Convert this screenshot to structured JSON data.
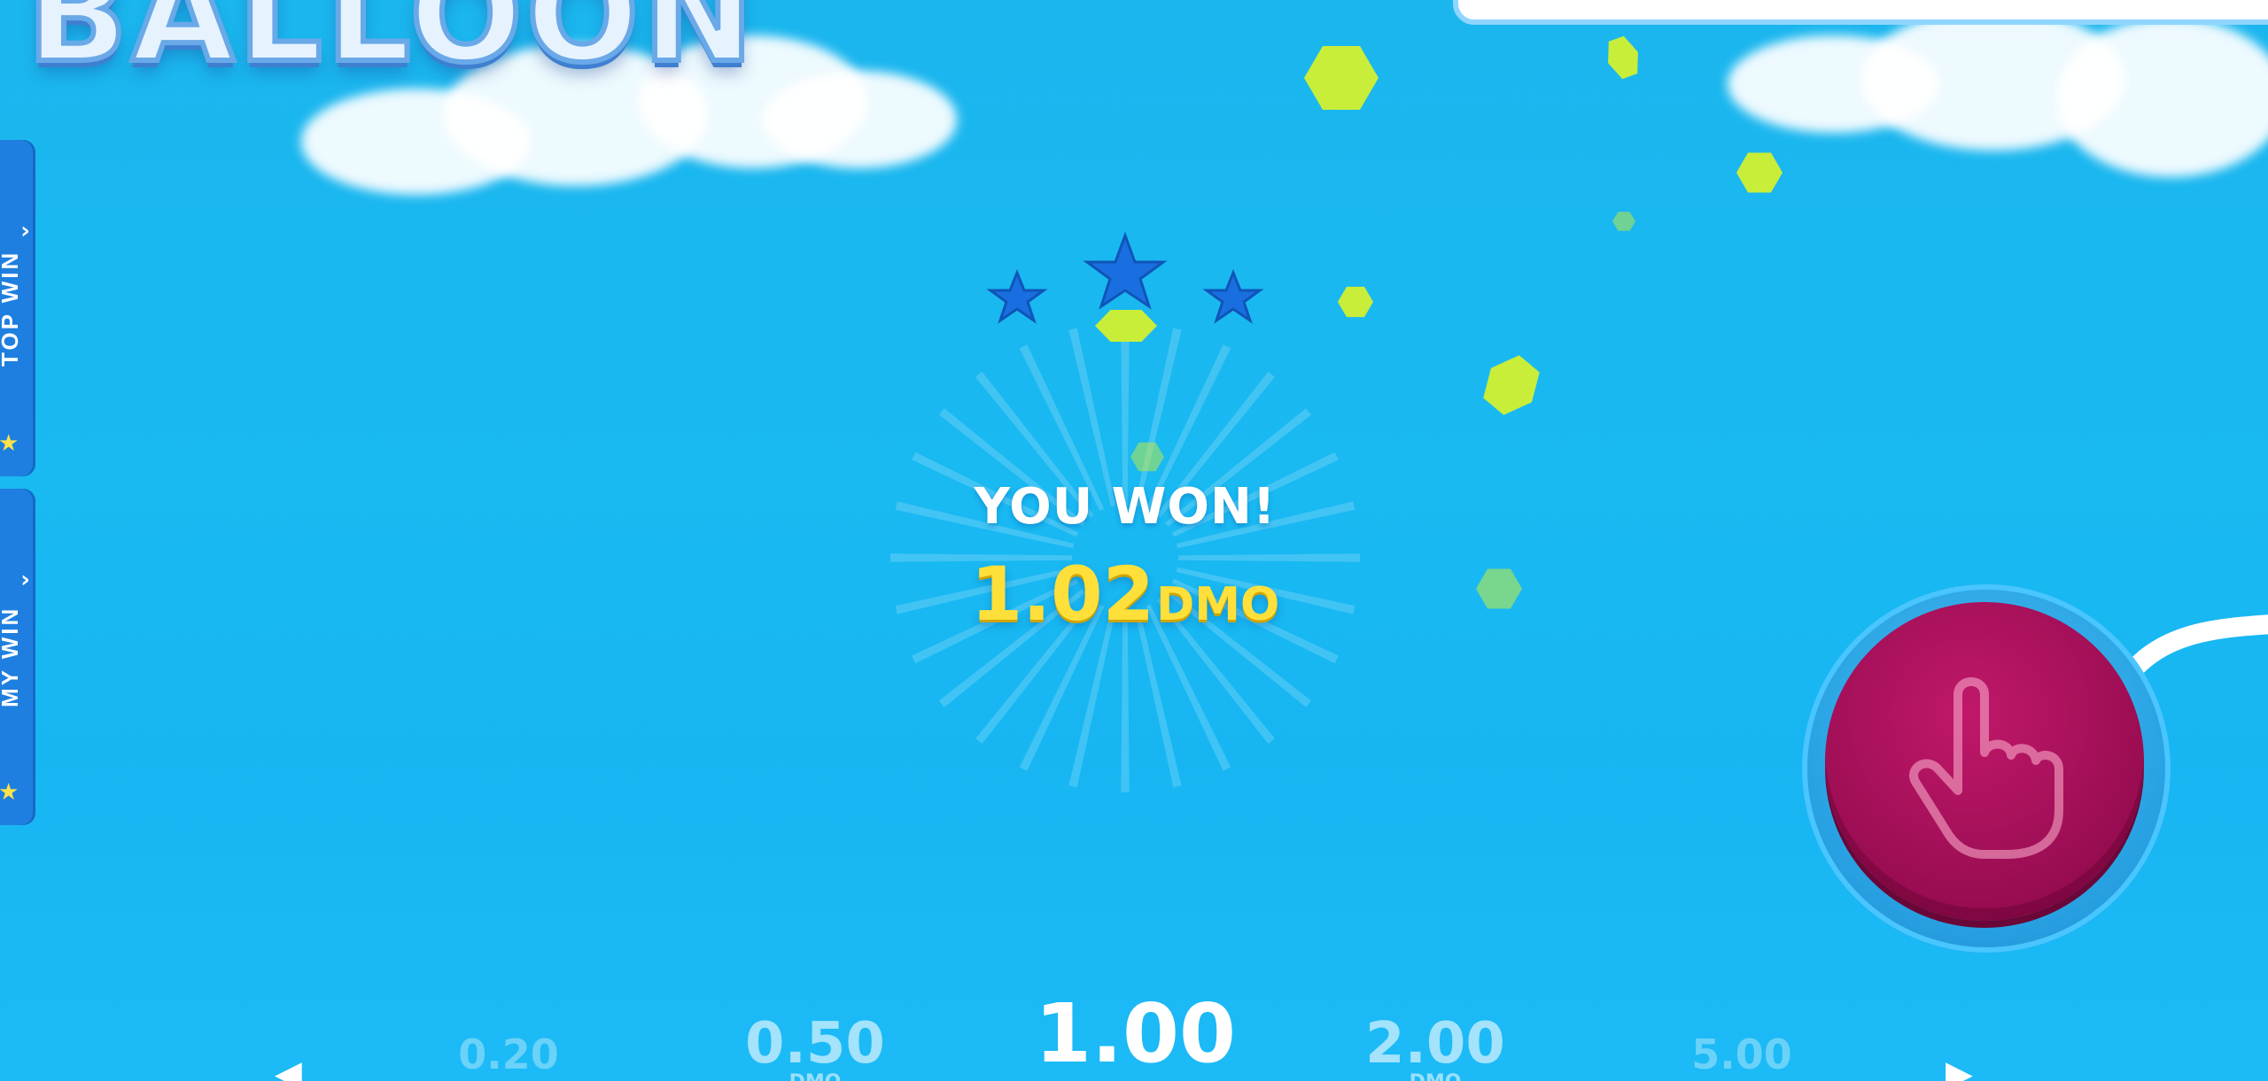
{
  "game": {
    "logo_text": "BALLOON"
  },
  "side_tabs": {
    "top_win": {
      "label": "TOP WIN",
      "chevron": "›",
      "star": "★"
    },
    "my_win": {
      "label": "MY WIN",
      "chevron": "›",
      "star": "★"
    }
  },
  "result": {
    "title": "YOU WON!",
    "amount": "1.02",
    "currency": "DMO",
    "stars_earned": 3
  },
  "bet_selector": {
    "options": [
      {
        "value": "0.20",
        "sub": ""
      },
      {
        "value": "0.50",
        "sub": "DMO"
      },
      {
        "value": "1.00",
        "sub": ""
      },
      {
        "value": "2.00",
        "sub": "DMO"
      },
      {
        "value": "5.00",
        "sub": ""
      }
    ],
    "selected": "1.00",
    "prev_arrow": "◀",
    "next_arrow": "▶"
  },
  "icons": {
    "pump_button": "hand-pointer-icon",
    "star": "star-icon",
    "coin": "coin-icon"
  },
  "colors": {
    "sky": "#19b9f2",
    "pump_button": "#a10f57",
    "win_amount": "#ffe03a",
    "side_tab": "#1f7fe0",
    "star_blue": "#1a6fe0"
  }
}
